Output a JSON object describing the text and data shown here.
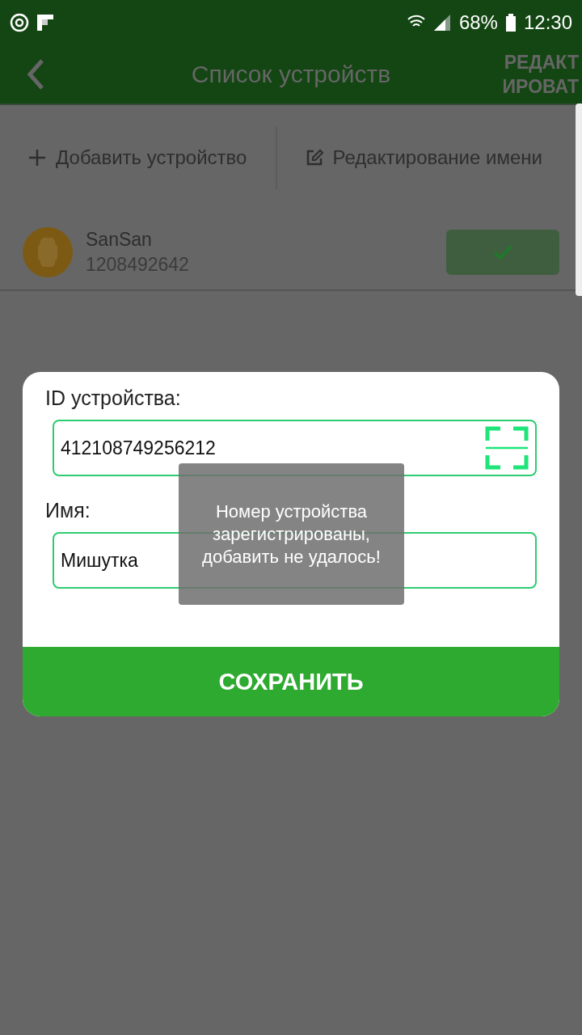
{
  "status_bar": {
    "battery": "68%",
    "time": "12:30"
  },
  "header": {
    "title": "Список устройств",
    "action_lines": [
      "РЕДАКТ",
      "ИРОВАТ"
    ]
  },
  "actions": [
    {
      "kind": "add",
      "label": "Добавить устройство"
    },
    {
      "kind": "edit",
      "label": "Редактирование имени"
    }
  ],
  "devices": [
    {
      "name": "SanSan",
      "number": "1208492642",
      "checked": true
    }
  ],
  "dialog": {
    "fields": [
      {
        "kind": "scan",
        "label": "ID устройства:",
        "value": "412108749256212"
      },
      {
        "kind": "text",
        "label": "Имя:",
        "value": "Мишутка"
      }
    ],
    "button": "СОХРАНИТЬ"
  },
  "toast": "Номер устройства зарегистрированы, добавить не удалось!"
}
